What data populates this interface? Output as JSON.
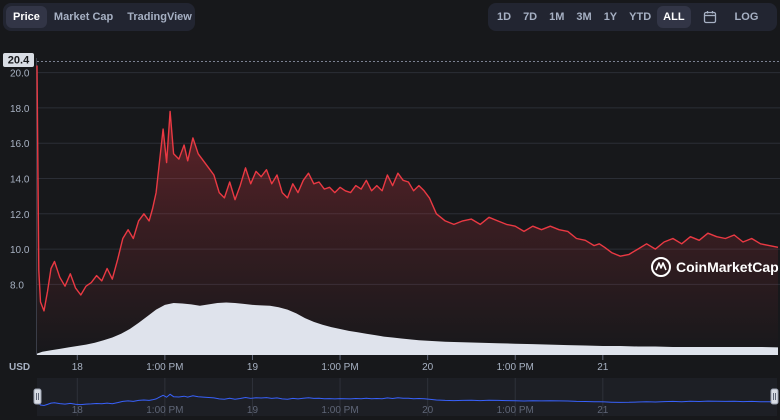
{
  "tabs": [
    {
      "label": "Price",
      "active": true
    },
    {
      "label": "Market Cap",
      "active": false
    },
    {
      "label": "TradingView",
      "active": false
    }
  ],
  "ranges": [
    {
      "label": "1D",
      "active": false
    },
    {
      "label": "7D",
      "active": false
    },
    {
      "label": "1M",
      "active": false
    },
    {
      "label": "3M",
      "active": false
    },
    {
      "label": "1Y",
      "active": false
    },
    {
      "label": "YTD",
      "active": false
    },
    {
      "label": "ALL",
      "active": true
    }
  ],
  "log_label": "LOG",
  "calendar_icon": "calendar-icon",
  "watermark": "CoinMarketCap",
  "watermark_icon": "coinmarketcap-logo-icon",
  "currency_label": "USD",
  "colors": {
    "price_line": "#ea3943",
    "volume_fill": "#dfe3ec",
    "navigator_line": "#3861fb",
    "background": "#17181b",
    "grid": "#2b2e36"
  },
  "chart_data": {
    "type": "line",
    "title": "",
    "xlabel": "",
    "ylabel": "",
    "current_price_label": "20.4",
    "y_ticks": [
      "8.0",
      "10.0",
      "12.0",
      "14.0",
      "16.0",
      "18.0",
      "20.0"
    ],
    "y_tick_values": [
      8,
      10,
      12,
      14,
      16,
      18,
      20
    ],
    "ylim": [
      4.0,
      20.6
    ],
    "x_tick_labels": [
      "18",
      "1:00 PM",
      "19",
      "1:00 PM",
      "20",
      "1:00 PM",
      "21"
    ],
    "x_tick_values": [
      18.0,
      18.5,
      19.0,
      19.5,
      20.0,
      20.5,
      21.0
    ],
    "xlim": [
      17.77,
      22.0
    ],
    "grid": true,
    "legend": "none",
    "series": [
      {
        "role": "price",
        "x": [
          17.77,
          17.78,
          17.79,
          17.81,
          17.83,
          17.85,
          17.87,
          17.9,
          17.93,
          17.96,
          17.99,
          18.02,
          18.05,
          18.08,
          18.11,
          18.14,
          18.17,
          18.2,
          18.23,
          18.26,
          18.29,
          18.32,
          18.35,
          18.38,
          18.41,
          18.43,
          18.45,
          18.47,
          18.49,
          18.51,
          18.53,
          18.55,
          18.58,
          18.61,
          18.63,
          18.66,
          18.69,
          18.72,
          18.75,
          18.78,
          18.81,
          18.84,
          18.87,
          18.9,
          18.93,
          18.96,
          18.99,
          19.02,
          19.05,
          19.08,
          19.11,
          19.14,
          19.17,
          19.2,
          19.23,
          19.26,
          19.29,
          19.32,
          19.35,
          19.38,
          19.41,
          19.44,
          19.47,
          19.5,
          19.53,
          19.56,
          19.59,
          19.62,
          19.65,
          19.68,
          19.71,
          19.74,
          19.77,
          19.8,
          19.83,
          19.86,
          19.89,
          19.92,
          19.95,
          19.98,
          20.01,
          20.05,
          20.1,
          20.15,
          20.2,
          20.25,
          20.3,
          20.35,
          20.4,
          20.45,
          20.5,
          20.55,
          20.6,
          20.65,
          20.7,
          20.75,
          20.8,
          20.85,
          20.9,
          20.95,
          20.98,
          21.01,
          21.05,
          21.1,
          21.15,
          21.2,
          21.25,
          21.3,
          21.35,
          21.4,
          21.45,
          21.5,
          21.55,
          21.6,
          21.65,
          21.7,
          21.75,
          21.8,
          21.85,
          21.9,
          21.95,
          22.0
        ],
        "y": [
          20.4,
          8.8,
          7.0,
          6.5,
          7.6,
          8.9,
          9.3,
          8.4,
          7.9,
          8.6,
          7.8,
          7.4,
          7.9,
          8.1,
          8.5,
          8.2,
          8.9,
          8.3,
          9.4,
          10.6,
          11.1,
          10.6,
          11.6,
          12.0,
          11.6,
          12.3,
          13.2,
          15.0,
          16.8,
          14.9,
          17.8,
          15.4,
          15.1,
          15.9,
          15.0,
          16.3,
          15.4,
          15.0,
          14.6,
          14.2,
          13.2,
          12.9,
          13.8,
          12.8,
          13.6,
          14.6,
          13.7,
          14.4,
          14.1,
          14.5,
          13.7,
          14.2,
          13.2,
          12.9,
          13.7,
          13.2,
          13.9,
          14.3,
          13.7,
          13.8,
          13.4,
          13.5,
          13.2,
          13.5,
          13.3,
          13.2,
          13.6,
          13.4,
          13.9,
          13.3,
          13.6,
          13.3,
          14.2,
          13.6,
          14.3,
          13.9,
          13.8,
          13.3,
          13.6,
          13.3,
          12.9,
          12.0,
          11.6,
          11.4,
          11.6,
          11.7,
          11.4,
          11.8,
          11.6,
          11.4,
          11.3,
          11.0,
          11.3,
          11.1,
          11.3,
          11.1,
          11.0,
          10.6,
          10.5,
          10.2,
          10.3,
          10.1,
          9.8,
          9.6,
          9.7,
          10.0,
          10.3,
          10.0,
          10.4,
          10.6,
          10.3,
          10.7,
          10.5,
          10.9,
          10.7,
          10.6,
          10.8,
          10.4,
          10.6,
          10.3,
          10.2,
          10.1
        ]
      },
      {
        "role": "volume",
        "x": [
          17.77,
          17.8,
          17.85,
          17.9,
          17.95,
          18.0,
          18.05,
          18.1,
          18.15,
          18.2,
          18.25,
          18.3,
          18.35,
          18.4,
          18.45,
          18.5,
          18.55,
          18.6,
          18.65,
          18.7,
          18.75,
          18.8,
          18.85,
          18.9,
          18.95,
          19.0,
          19.05,
          19.1,
          19.15,
          19.2,
          19.25,
          19.3,
          19.35,
          19.4,
          19.45,
          19.5,
          19.55,
          19.6,
          19.65,
          19.7,
          19.75,
          19.8,
          19.85,
          19.9,
          19.95,
          20.0,
          20.1,
          20.2,
          20.3,
          20.4,
          20.5,
          20.6,
          20.7,
          20.8,
          20.9,
          21.0,
          21.1,
          21.2,
          21.3,
          21.4,
          21.5,
          21.6,
          21.7,
          21.8,
          21.9,
          22.0
        ],
        "y": [
          3,
          7,
          10,
          13,
          16,
          19,
          22,
          26,
          31,
          37,
          45,
          55,
          68,
          82,
          96,
          106,
          110,
          109,
          107,
          104,
          107,
          110,
          111,
          110,
          108,
          106,
          105,
          104,
          101,
          96,
          88,
          78,
          70,
          64,
          59,
          55,
          51,
          48,
          45,
          42,
          39,
          37,
          35,
          33,
          31,
          30,
          28,
          27,
          26,
          25,
          24,
          23,
          22,
          21,
          20,
          19,
          19,
          18,
          18,
          17,
          17,
          17,
          17,
          17,
          17,
          16
        ]
      }
    ]
  },
  "navigator": {
    "x_tick_labels": [
      "18",
      "1:00 PM",
      "19",
      "1:00 PM",
      "20",
      "1:00 PM",
      "21"
    ],
    "handle_left_icon": "drag-handle-icon",
    "handle_right_icon": "drag-handle-icon"
  }
}
